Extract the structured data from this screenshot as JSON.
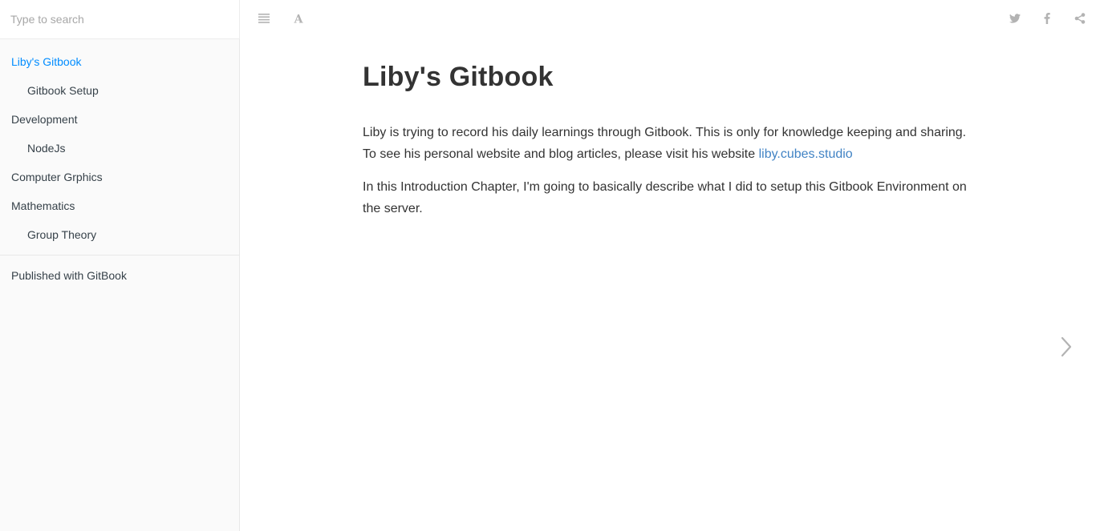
{
  "search": {
    "placeholder": "Type to search"
  },
  "sidebar": {
    "items": [
      {
        "label": "Liby's Gitbook"
      },
      {
        "label": "Gitbook Setup"
      },
      {
        "label": "Development"
      },
      {
        "label": "NodeJs"
      },
      {
        "label": "Computer Grphics"
      },
      {
        "label": "Mathematics"
      },
      {
        "label": "Group Theory"
      }
    ],
    "published": "Published with GitBook"
  },
  "toolbar": {
    "icons": [
      "menu-icon",
      "font-settings-icon",
      "twitter-icon",
      "facebook-icon",
      "share-icon"
    ]
  },
  "page": {
    "title": "Liby's Gitbook",
    "para1_text": "Liby is trying to record his daily learnings through Gitbook. This is only for knowledge keeping and sharing. To see his personal website and blog articles, please visit his website ",
    "para1_link": "liby.cubes.studio",
    "para2_text": "In this Introduction Chapter, I'm going to basically describe what I did to setup this Gitbook Environment on the server."
  },
  "colors": {
    "active": "#008cff",
    "link": "#4183c4",
    "icon": "#b3b3b3",
    "sidebar_bg": "#fafafa"
  }
}
